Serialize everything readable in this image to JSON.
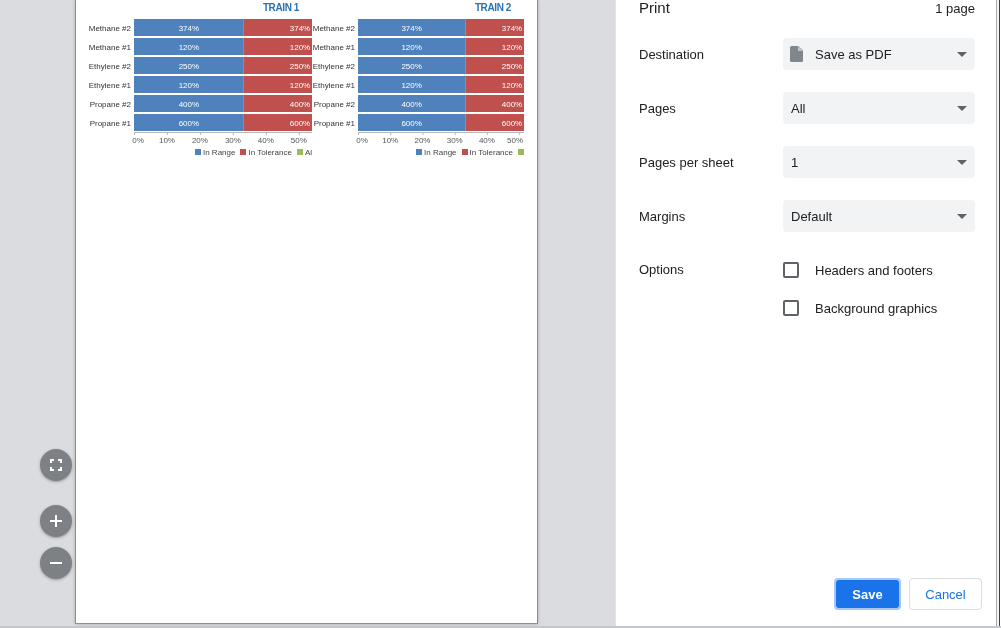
{
  "preview": {
    "charts": [
      {
        "chart_data": {
          "type": "bar",
          "orientation": "horizontal",
          "stacked": true,
          "title": "TRAIN 1",
          "categories": [
            "Methane #2",
            "Methane #1",
            "Ethylene #2",
            "Ethylene #1",
            "Propane #2",
            "Propane #1"
          ],
          "series": [
            {
              "name": "In Range",
              "color": "#4f81bd",
              "values": [
                33.3,
                33.3,
                33.3,
                33.3,
                33.3,
                33.3
              ]
            },
            {
              "name": "In Tolerance",
              "color": "#c0504d",
              "values": [
                20.7,
                20.7,
                20.7,
                20.7,
                20.7,
                20.7
              ]
            },
            {
              "name": "Al",
              "color": "#9bbb59",
              "values": [
                0,
                0,
                0,
                0,
                0,
                0
              ]
            }
          ],
          "xlim": [
            0,
            54
          ],
          "xticks": [
            {
              "value": 0,
              "label": "0%"
            },
            {
              "value": 10,
              "label": "10%"
            },
            {
              "value": 20,
              "label": "20%"
            },
            {
              "value": 30,
              "label": "30%"
            },
            {
              "value": 40,
              "label": "40%"
            },
            {
              "value": 50,
              "label": "50%"
            }
          ],
          "value_labels": [
            [
              "374%",
              "120%",
              "250%",
              "120%",
              "400%",
              "600%"
            ],
            [
              "374%",
              "120%",
              "250%",
              "120%",
              "400%",
              "600%"
            ]
          ],
          "legend": "bottom"
        }
      },
      {
        "chart_data": {
          "type": "bar",
          "orientation": "horizontal",
          "stacked": true,
          "title": "TRAIN 2",
          "categories": [
            "Methane #2",
            "Methane #1",
            "Ethylene #2",
            "Ethylene #1",
            "Propane #2",
            "Propane #1"
          ],
          "series": [
            {
              "name": "In Range",
              "color": "#4f81bd",
              "values": [
                33.3,
                33.3,
                33.3,
                33.3,
                33.3,
                33.3
              ]
            },
            {
              "name": "In Tolerance",
              "color": "#c0504d",
              "values": [
                18.2,
                18.2,
                18.2,
                18.2,
                18.2,
                18.2
              ]
            },
            {
              "color": "#9bbb59",
              "values": [
                0,
                0,
                0,
                0,
                0,
                0
              ]
            }
          ],
          "xlim": [
            0,
            51.5
          ],
          "xticks": [
            {
              "value": 0,
              "label": "0%"
            },
            {
              "value": 10,
              "label": "10%"
            },
            {
              "value": 20,
              "label": "20%"
            },
            {
              "value": 30,
              "label": "30%"
            },
            {
              "value": 40,
              "label": "40%"
            },
            {
              "value": 50,
              "label": "50%"
            }
          ],
          "value_labels": [
            [
              "374%",
              "120%",
              "250%",
              "120%",
              "400%",
              "600%"
            ],
            [
              "374%",
              "120%",
              "250%",
              "120%",
              "400%",
              "600%"
            ]
          ],
          "legend": "bottom"
        }
      }
    ],
    "controls": [
      {
        "kind": "fit"
      },
      {
        "kind": "zoom_in"
      },
      {
        "kind": "zoom_out"
      }
    ]
  },
  "settings": {
    "title": "Print",
    "page_count": "1 page",
    "fields": [
      {
        "label": "Destination",
        "value": "Save as PDF",
        "kind": "document"
      },
      {
        "label": "Pages",
        "value": "All",
        "kind": "plain"
      },
      {
        "label": "Pages per sheet",
        "value": "1",
        "kind": "plain"
      },
      {
        "label": "Margins",
        "value": "Default",
        "kind": "plain"
      }
    ],
    "options_label": "Options",
    "options": [
      {
        "label": "Headers and footers",
        "checked": false
      },
      {
        "label": "Background graphics",
        "checked": false
      }
    ]
  },
  "buttons": [
    {
      "label": "Save",
      "kind": "primary"
    },
    {
      "label": "Cancel",
      "kind": "secondary"
    }
  ]
}
